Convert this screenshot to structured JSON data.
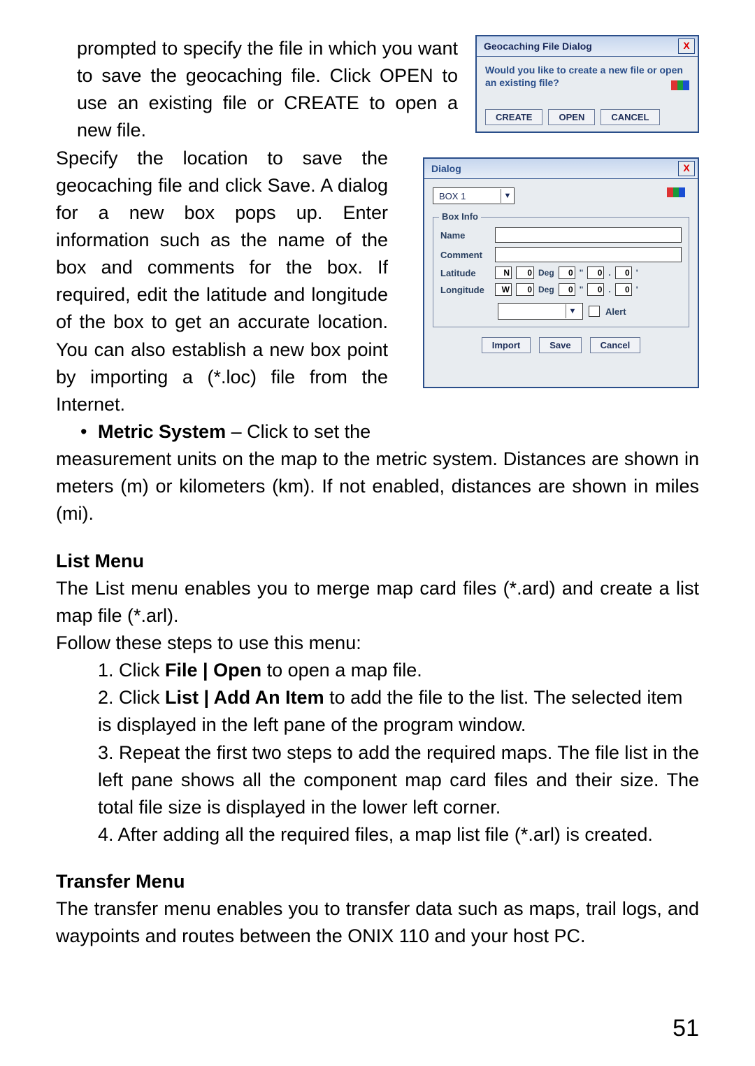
{
  "page_number": "51",
  "paragraphs": {
    "p1": "prompted to specify the file in which you want to save the geocaching file. Click OPEN to use an existing file or CREATE to open a new file.",
    "p2": "Specify the location to save the geocaching file and click Save. A dialog for a new box pops up. Enter information such as the name of the box and comments for the box. If required, edit the latitude and longitude of the box to get an accurate location. You can also establish  a new box point by importing a (*.loc) file from  the Internet.",
    "bullet_label": "Metric System",
    "bullet_rest_line": " – Click to set the",
    "p3_rest": "measurement units on the map to the metric system. Distances are shown in meters (m) or kilometers (km). If not enabled, distances are shown in miles (mi).",
    "list_head": "List Menu",
    "list_p1": "The List menu enables you to merge map card files (*.ard) and create a list map file (*.arl).",
    "list_p2": "Follow these steps to use this menu:",
    "steps": {
      "s1a": "1. Click ",
      "s1b": "File | Open",
      "s1c": " to open a map file.",
      "s2a": "2. Click ",
      "s2b": "List | Add An Item",
      "s2c": " to add the file to the list. The selected item is displayed in the left pane of the program window.",
      "s3": "3. Repeat the first two steps to add the required maps. The file list in the left pane shows all the component map card files and their size. The total file size is displayed in the lower left corner.",
      "s4": "4. After adding all the required files, a map list file (*.arl) is created."
    },
    "transfer_head": "Transfer Menu",
    "transfer_p": "The transfer menu enables you to transfer data such as maps, trail logs, and waypoints and routes between the ONIX 110 and your host PC."
  },
  "dialog1": {
    "title": "Geocaching File Dialog",
    "close_icon": "X",
    "prompt": "Would you like to create a new file or open an existing file?",
    "buttons": {
      "create": "CREATE",
      "open": "OPEN",
      "cancel": "CANCEL"
    }
  },
  "dialog2": {
    "title": "Dialog",
    "close_icon": "X",
    "combo_value": "BOX 1",
    "fieldset_legend": "Box Info",
    "labels": {
      "name": "Name",
      "comment": "Comment",
      "latitude": "Latitude",
      "longitude": "Longitude"
    },
    "lat": {
      "dir": "N",
      "deg": "0",
      "unit_deg": "Deg",
      "min": "0",
      "sym_min": "\"",
      "whole": "0",
      "dot": ".",
      "frac": "0",
      "sym_sec": "'"
    },
    "lon": {
      "dir": "W",
      "deg": "0",
      "unit_deg": "Deg",
      "min": "0",
      "sym_min": "\"",
      "whole": "0",
      "dot": ".",
      "frac": "0",
      "sym_sec": "'"
    },
    "alert_label": "Alert",
    "buttons": {
      "import": "Import",
      "save": "Save",
      "cancel": "Cancel"
    }
  }
}
